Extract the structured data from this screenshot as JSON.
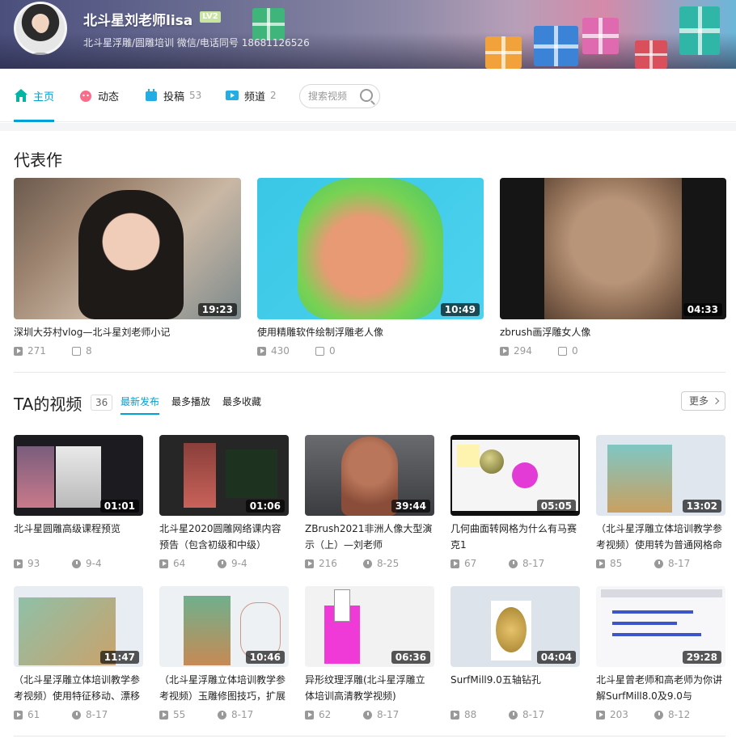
{
  "header": {
    "username": "北斗星刘老师lisa",
    "level": "LV2",
    "sign": "北斗星浮雕/圆雕培训 微信/电话同号 18681126526"
  },
  "nav": {
    "home": "主页",
    "dynamic": "动态",
    "contrib": "投稿",
    "contrib_count": "53",
    "channel": "频道",
    "channel_count": "2",
    "search_placeholder": "搜索视频"
  },
  "featured": {
    "title": "代表作",
    "items": [
      {
        "title": "深圳大芬村vlog—北斗星刘老师小记",
        "duration": "19:23",
        "plays": "271",
        "danmaku": "8"
      },
      {
        "title": "使用精雕软件绘制浮雕老人像",
        "duration": "10:49",
        "plays": "430",
        "danmaku": "0"
      },
      {
        "title": "zbrush画浮雕女人像",
        "duration": "04:33",
        "plays": "294",
        "danmaku": "0"
      }
    ]
  },
  "videos": {
    "title": "TA的视频",
    "count": "36",
    "tabs": [
      "最新发布",
      "最多播放",
      "最多收藏"
    ],
    "more": "更多",
    "items": [
      {
        "title": "北斗星圆雕高级课程预览",
        "duration": "01:01",
        "plays": "93",
        "date": "9-4"
      },
      {
        "title": "北斗星2020圆雕网络课内容预告（包含初级和中级）",
        "duration": "01:06",
        "plays": "64",
        "date": "9-4"
      },
      {
        "title": "ZBrush2021非洲人像大型演示（上）—刘老师",
        "duration": "39:44",
        "plays": "216",
        "date": "8-25"
      },
      {
        "title": "几何曲面转网格为什么有马赛克1",
        "duration": "05:05",
        "plays": "67",
        "date": "8-17"
      },
      {
        "title": "（北斗星浮雕立体培训教学参考视频）使用转为普通网格命",
        "duration": "13:02",
        "plays": "85",
        "date": "8-17"
      },
      {
        "title": "（北斗星浮雕立体培训教学参考视频）使用特征移动、漂移",
        "duration": "11:47",
        "plays": "61",
        "date": "8-17"
      },
      {
        "title": "（北斗星浮雕立体培训教学参考视频）玉雕修图技巧，扩展",
        "duration": "10:46",
        "plays": "55",
        "date": "8-17"
      },
      {
        "title": "异形纹理浮雕(北斗星浮雕立体培训高清教学视频)",
        "duration": "06:36",
        "plays": "62",
        "date": "8-17"
      },
      {
        "title": "SurfMill9.0五轴钻孔",
        "duration": "04:04",
        "plays": "88",
        "date": "8-17"
      },
      {
        "title": "北斗星曾老师和高老师为你讲解SurfMill8.0及9.0与",
        "duration": "29:28",
        "plays": "203",
        "date": "8-12"
      }
    ]
  }
}
